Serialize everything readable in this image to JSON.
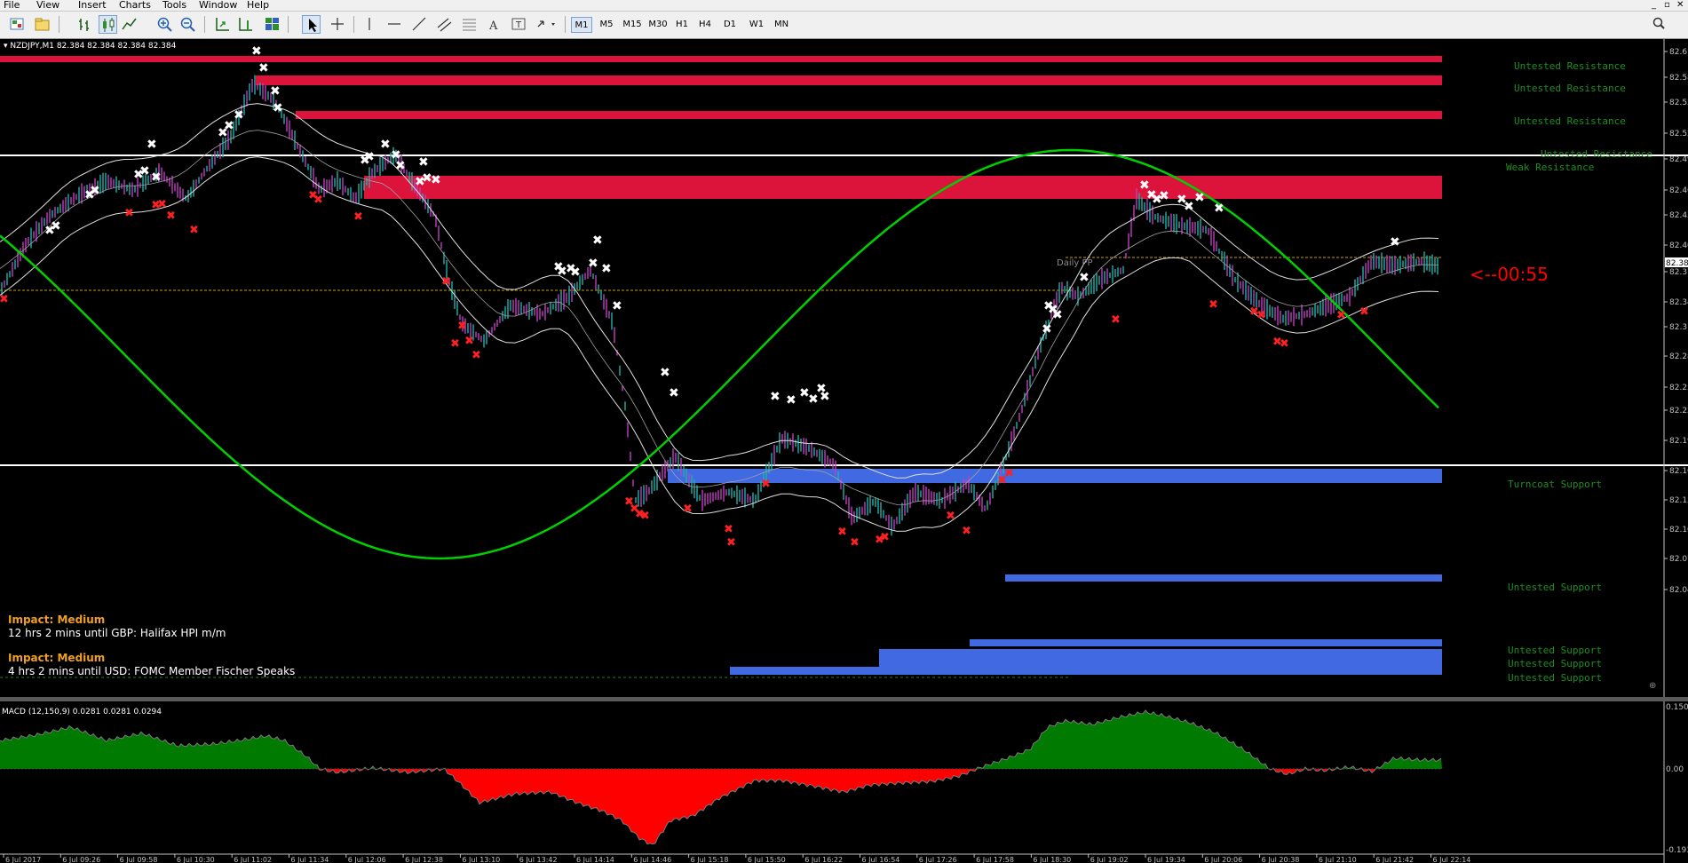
{
  "menu": {
    "items": [
      "File",
      "View",
      "Insert",
      "Charts",
      "Tools",
      "Window",
      "Help"
    ]
  },
  "window_controls": {
    "minimize": "_",
    "restore": "▫",
    "close": "✕"
  },
  "toolbar": {
    "timeframes": [
      "M1",
      "M5",
      "M15",
      "M30",
      "H1",
      "H4",
      "D1",
      "W1",
      "MN"
    ],
    "active_timeframe": "M1"
  },
  "chart": {
    "title": "NZDJPY,M1  82.384 82.384 82.384 82.384",
    "price_axis": [
      "82.61",
      "82.58",
      "82.55",
      "82.52",
      "82.49",
      "82.46",
      "82.43",
      "82.40",
      "82.38",
      "82.37",
      "82.34",
      "82.31",
      "82.28",
      "82.25",
      "82.22",
      "82.19",
      "82.16",
      "82.13",
      "82.10",
      "82.07",
      "82.04"
    ],
    "current_price": "82.384",
    "countdown": "<--00:55",
    "pivot_label": "Daily PP",
    "zone_labels": [
      "Untested Resistance",
      "Untested Resistance",
      "Untested Resistance",
      "Untested Resistance",
      "Weak Resistance",
      "Turncoat Support",
      "Untested Support",
      "Untested Support",
      "Untested Support",
      "Untested Support"
    ],
    "time_axis": [
      "6 Jul 2017",
      "6 Jul 09:26",
      "6 Jul 09:58",
      "6 Jul 10:30",
      "6 Jul 11:02",
      "6 Jul 11:34",
      "6 Jul 12:06",
      "6 Jul 12:38",
      "6 Jul 13:10",
      "6 Jul 13:42",
      "6 Jul 14:14",
      "6 Jul 14:46",
      "6 Jul 15:18",
      "6 Jul 15:50",
      "6 Jul 16:22",
      "6 Jul 16:54",
      "6 Jul 17:26",
      "6 Jul 17:58",
      "6 Jul 18:30",
      "6 Jul 19:02",
      "6 Jul 19:34",
      "6 Jul 20:06",
      "6 Jul 20:38",
      "6 Jul 21:10",
      "6 Jul 21:42",
      "6 Jul 22:14"
    ],
    "news": [
      {
        "impact": "Impact: Medium",
        "text": "12 hrs 2 mins until GBP: Halifax HPI m/m"
      },
      {
        "impact": "Impact: Medium",
        "text": "4 hrs 2 mins until USD: FOMC Member Fischer Speaks"
      }
    ]
  },
  "macd": {
    "title": "MACD (12,150,9) 0.0281 0.0281 0.0294",
    "axis": [
      "0.1505",
      "0.00",
      "-0.1932"
    ]
  },
  "colors": {
    "resistance_zone": "#dc143c",
    "support_zone": "#4169e1",
    "zone_label": "#1e8e1e",
    "sine_wave": "#00d000",
    "countdown": "#ff0000",
    "macd_positive": "#007a00",
    "macd_negative": "#ff0000",
    "pivot_line": "#c8a000"
  },
  "icons": [
    "new-chart-icon",
    "profiles-icon",
    "bar-chart-icon",
    "candle-chart-icon",
    "line-chart-icon",
    "zoom-in-icon",
    "zoom-out-icon",
    "tile-windows-icon",
    "autoscroll-icon",
    "chart-shift-icon",
    "cursor-icon",
    "crosshair-icon",
    "vertical-line-icon",
    "horizontal-line-icon",
    "trendline-icon",
    "channel-icon",
    "fibonacci-icon",
    "text-icon",
    "text-label-icon",
    "arrows-icon",
    "search-icon"
  ]
}
